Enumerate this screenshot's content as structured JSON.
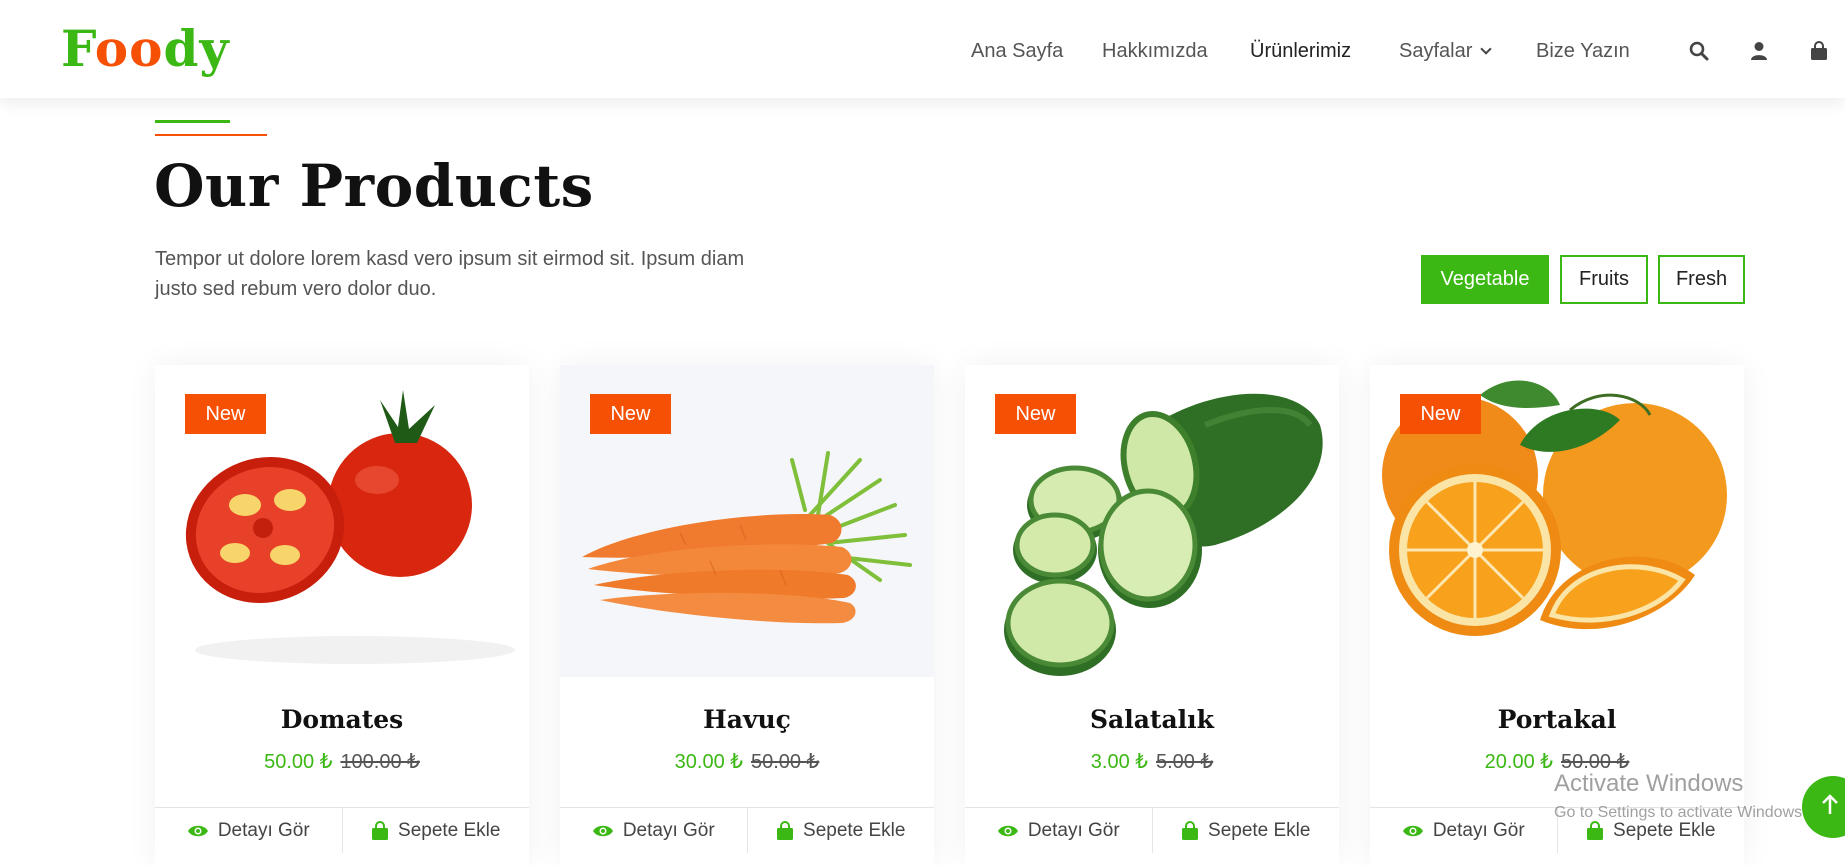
{
  "brand": {
    "logo_letters": [
      "F",
      "o",
      "o",
      "d",
      "y"
    ],
    "green": "#3cb815",
    "orange": "#f65005"
  },
  "nav": {
    "items": [
      {
        "label": "Ana Sayfa"
      },
      {
        "label": "Hakkımızda"
      },
      {
        "label": "Ürünlerimiz",
        "active": true
      },
      {
        "label": "Sayfalar",
        "dropdown": true
      },
      {
        "label": "Bize Yazın"
      }
    ],
    "icons": [
      "search-icon",
      "user-icon",
      "shopping-bag-icon"
    ]
  },
  "section": {
    "title": "Our Products",
    "description": "Tempor ut dolore lorem kasd vero ipsum sit eirmod sit. Ipsum diam justo sed rebum vero dolor duo."
  },
  "filters": [
    {
      "label": "Vegetable",
      "active": true
    },
    {
      "label": "Fruits",
      "active": false
    },
    {
      "label": "Fresh",
      "active": false
    }
  ],
  "products": [
    {
      "badge": "New",
      "name": "Domates",
      "price": "50.00 ₺",
      "old_price": "100.00 ₺",
      "image": "tomato"
    },
    {
      "badge": "New",
      "name": "Havuç",
      "price": "30.00 ₺",
      "old_price": "50.00 ₺",
      "image": "carrot"
    },
    {
      "badge": "New",
      "name": "Salatalık",
      "price": "3.00 ₺",
      "old_price": "5.00 ₺",
      "image": "cucumber"
    },
    {
      "badge": "New",
      "name": "Portakal",
      "price": "20.00 ₺",
      "old_price": "50.00 ₺",
      "image": "orange"
    }
  ],
  "card_actions": {
    "detail": "Detayı Gör",
    "cart": "Sepete Ekle"
  },
  "windows_watermark": {
    "title": "Activate Windows",
    "subtitle": "Go to Settings to activate Windows."
  }
}
